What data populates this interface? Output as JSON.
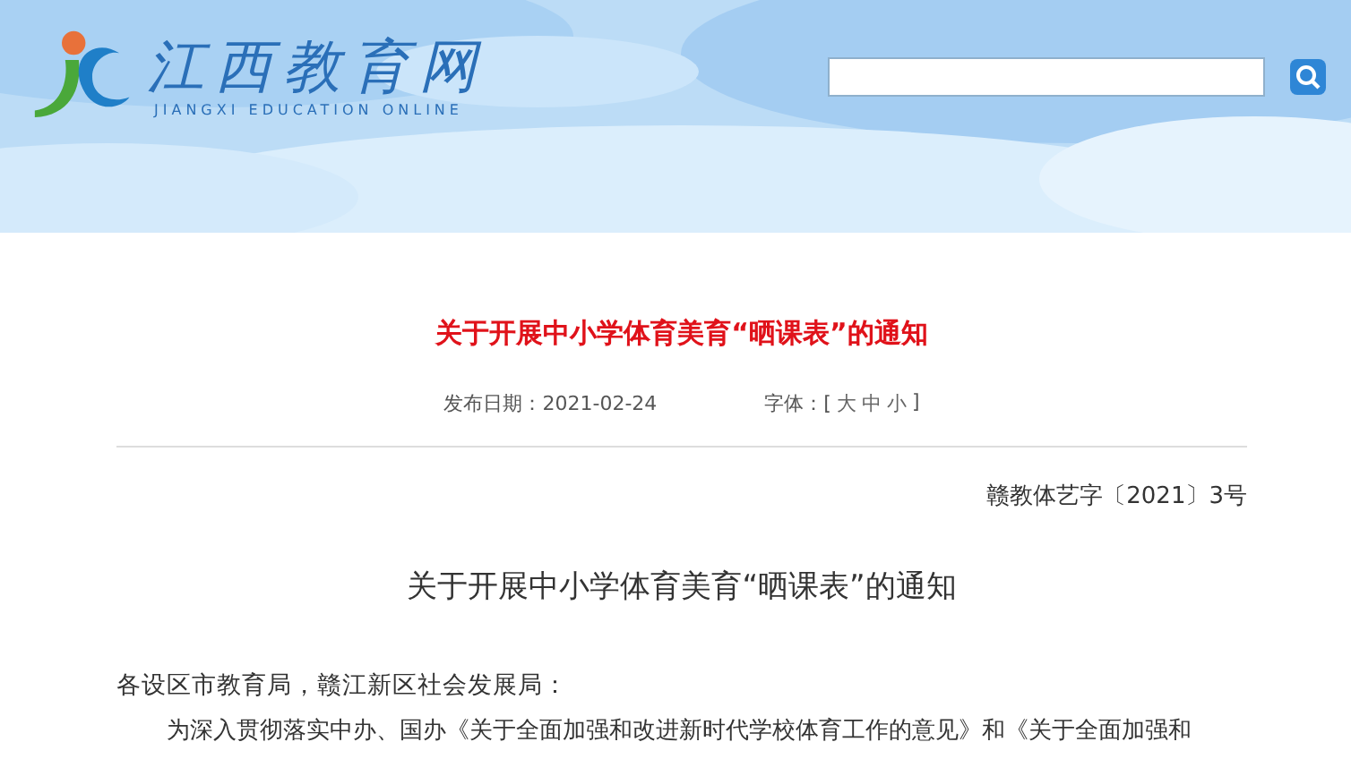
{
  "header": {
    "site_name": "江西教育网",
    "site_name_en": "JIANGXI EDUCATION ONLINE"
  },
  "article": {
    "title": "关于开展中小学体育美育“晒课表”的通知",
    "publish_date": "发布日期：2021-02-24",
    "font_size_label": "字体：[",
    "font_sizes": [
      {
        "label": "大"
      },
      {
        "label": "中"
      },
      {
        "label": "小"
      }
    ],
    "font_size_end": "]"
  },
  "document": {
    "number": "赣教体艺字〔2021〕3号",
    "heading": "关于开展中小学体育美育“晒课表”的通知",
    "salutation": "各设区市教育局，赣江新区社会发展局：",
    "paragraph": "为深入贯彻落实中办、国办《关于全面加强和改进新时代学校体育工作的意见》和《关于全面加强和"
  }
}
